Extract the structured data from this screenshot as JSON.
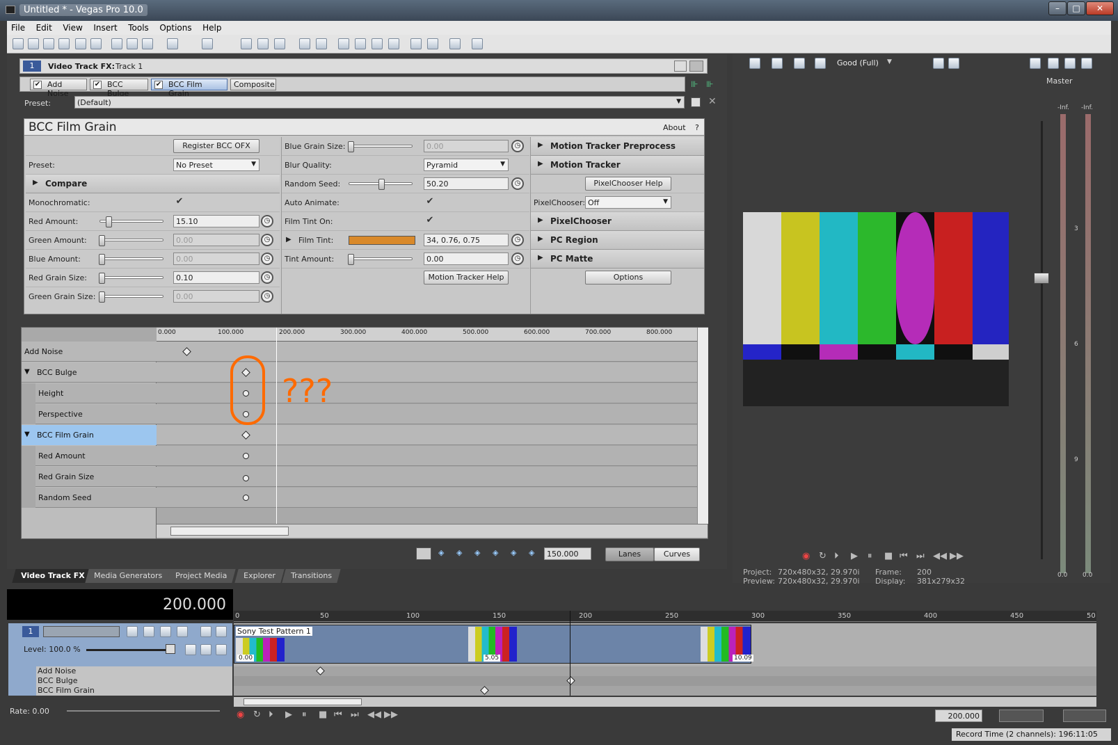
{
  "window": {
    "title": "Untitled * - Vegas Pro 10.0"
  },
  "menu": [
    "File",
    "Edit",
    "View",
    "Insert",
    "Tools",
    "Options",
    "Help"
  ],
  "fx_header": {
    "track_num": "1",
    "label": "Video Track FX:",
    "track": "Track 1"
  },
  "fx_chain": [
    {
      "name": "Add Noise",
      "enabled": true,
      "selected": false
    },
    {
      "name": "BCC Bulge",
      "enabled": true,
      "selected": false
    },
    {
      "name": "BCC Film Grain",
      "enabled": true,
      "selected": true
    },
    {
      "name": "Composite",
      "enabled": false,
      "selected": false
    }
  ],
  "preset": {
    "label": "Preset:",
    "value": "(Default)"
  },
  "plugin": {
    "name": "BCC Film Grain",
    "about": "About",
    "help": "?",
    "register_label": "Register BCC OFX",
    "preset_label": "Preset:",
    "preset_value": "No Preset",
    "compare_label": "Compare",
    "monochromatic_label": "Monochromatic:",
    "red_amount_label": "Red Amount:",
    "red_amount": "15.10",
    "green_amount_label": "Green Amount:",
    "green_amount": "0.00",
    "blue_amount_label": "Blue Amount:",
    "blue_amount": "0.00",
    "red_grain_label": "Red Grain Size:",
    "red_grain": "0.10",
    "green_grain_label": "Green Grain Size:",
    "green_grain": "0.00",
    "blue_grain_label": "Blue Grain Size:",
    "blue_grain": "0.00",
    "blur_quality_label": "Blur Quality:",
    "blur_quality": "Pyramid",
    "random_seed_label": "Random Seed:",
    "random_seed": "50.20",
    "auto_animate_label": "Auto Animate:",
    "film_tint_on_label": "Film Tint On:",
    "film_tint_label": "Film Tint:",
    "film_tint": "34, 0.76, 0.75",
    "film_tint_color": "#d9892a",
    "tint_amount_label": "Tint Amount:",
    "tint_amount": "0.00",
    "motion_tracker_help": "Motion Tracker Help",
    "mt_preprocess": "Motion Tracker Preprocess",
    "motion_tracker": "Motion Tracker",
    "pixelchooser_help": "PixelChooser Help",
    "pixelchooser_label": "PixelChooser:",
    "pixelchooser_value": "Off",
    "pixelchooser": "PixelChooser",
    "pc_region": "PC Region",
    "pc_matte": "PC Matte",
    "options": "Options"
  },
  "keyframes": {
    "ruler": [
      "0.000",
      "100.000",
      "200.000",
      "300.000",
      "400.000",
      "500.000",
      "600.000",
      "700.000",
      "800.000"
    ],
    "rows": [
      {
        "name": "Add Noise",
        "indent": 0,
        "expander": false,
        "selected": false
      },
      {
        "name": "BCC Bulge",
        "indent": 0,
        "expander": true,
        "selected": false
      },
      {
        "name": "Height",
        "indent": 1,
        "expander": false,
        "selected": false
      },
      {
        "name": "Perspective",
        "indent": 1,
        "expander": false,
        "selected": false
      },
      {
        "name": "BCC Film Grain",
        "indent": 0,
        "expander": true,
        "selected": true
      },
      {
        "name": "Red Amount",
        "indent": 1,
        "expander": false,
        "selected": false
      },
      {
        "name": "Red Grain Size",
        "indent": 1,
        "expander": false,
        "selected": false
      },
      {
        "name": "Random Seed",
        "indent": 1,
        "expander": false,
        "selected": false
      }
    ],
    "annotation": "???",
    "position": "150.000",
    "lanes": "Lanes",
    "curves": "Curves"
  },
  "tabs": [
    "Video Track FX",
    "Media Generators",
    "Project Media",
    "Explorer",
    "Transitions"
  ],
  "preview": {
    "quality": "Good (Full)",
    "project_label": "Project:",
    "project": "720x480x32, 29.970i",
    "preview_label": "Preview:",
    "preview": "720x480x32, 29.970i",
    "frame_label": "Frame:",
    "frame": "200",
    "display_label": "Display:",
    "display": "381x279x32"
  },
  "mixer": {
    "name": "Master",
    "left": "-Inf.",
    "right": "-Inf.",
    "marks": [
      "3",
      "6",
      "9"
    ],
    "lval": "0.0",
    "rval": "0.0"
  },
  "timeline": {
    "timecode": "200.000",
    "ruler": [
      "0",
      "50",
      "100",
      "150",
      "200",
      "250",
      "300",
      "350",
      "400",
      "450",
      "50"
    ],
    "track_num": "1",
    "level": "Level: 100.0 %",
    "clip_name": "Sony Test Pattern 1",
    "clip_times": [
      "0.00",
      "5.05",
      "10.09"
    ],
    "fx_rows": [
      "Add Noise",
      "BCC Bulge",
      "BCC Film Grain"
    ],
    "rate": "Rate: 0.00",
    "cursor": "200.000",
    "record_time": "Record Time (2 channels): 196:11:05"
  }
}
